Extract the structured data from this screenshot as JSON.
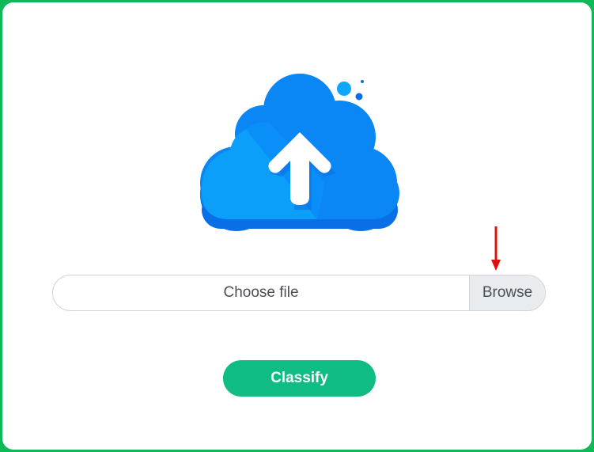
{
  "upload": {
    "file_placeholder": "Choose file",
    "browse_label": "Browse"
  },
  "actions": {
    "classify_label": "Classify"
  },
  "icons": {
    "cloud": "cloud-upload-icon",
    "annotation": "red-arrow-icon"
  },
  "colors": {
    "frame_border": "#0dba57",
    "cloud_light": "#0ea7fb",
    "cloud_dark": "#0a7bf2",
    "button": "#0fbc84",
    "annotation": "#e01010"
  }
}
